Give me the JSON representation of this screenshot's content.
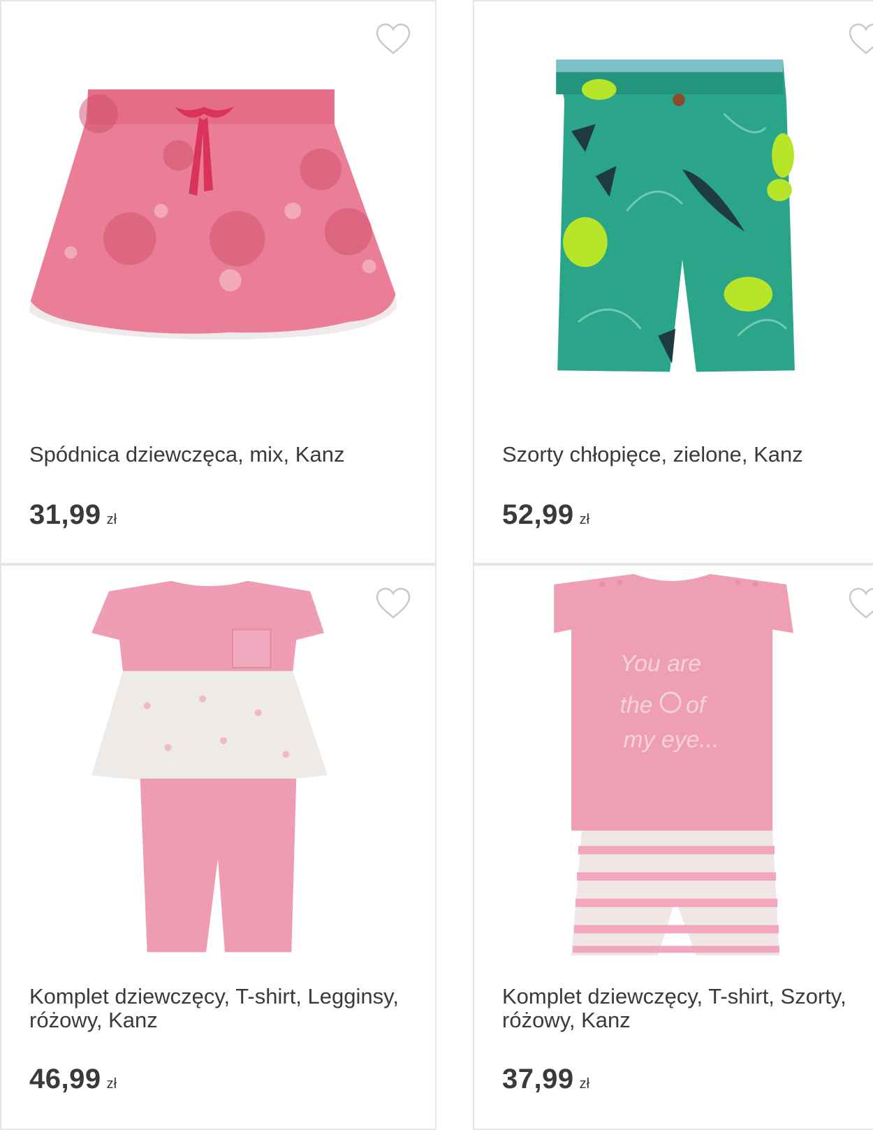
{
  "products": [
    {
      "name": "Spódnica dziewczęca, mix, Kanz",
      "price": "31,99",
      "currency": "zł"
    },
    {
      "name": "Szorty chłopięce, zielone, Kanz",
      "price": "52,99",
      "currency": "zł"
    },
    {
      "name": "Komplet dziewczęcy, T-shirt, Legginsy, różowy, Kanz",
      "price": "46,99",
      "currency": "zł"
    },
    {
      "name": "Komplet dziewczęcy, T-shirt, Szorty, różowy, Kanz",
      "price": "37,99",
      "currency": "zł"
    }
  ],
  "shirt_print": [
    "You are",
    "the",
    "of",
    "my eye..."
  ],
  "icons": {
    "wishlist": "heart-outline-icon"
  },
  "colors": {
    "border": "#e6e6e6",
    "text": "#3a3a3a",
    "heart": "#c9c9c9"
  }
}
